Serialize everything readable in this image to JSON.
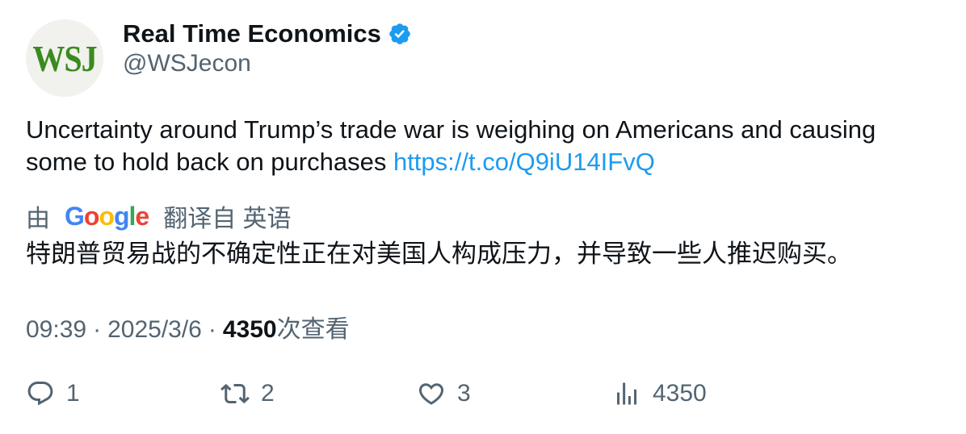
{
  "account": {
    "avatar_text": "WSJ",
    "display_name": "Real Time Economics",
    "handle": "@WSJecon",
    "verified_icon": "verified-badge-icon"
  },
  "tweet": {
    "text": "Uncertainty around Trump’s trade war is weighing on Americans and causing some to hold back on purchases",
    "link": "https://t.co/Q9iU14IFvQ"
  },
  "translation": {
    "prefix": "由",
    "provider": "Google",
    "suffix": "翻译自 英语",
    "text": "特朗普贸易战的不确定性正在对美国人构成压力，并导致一些人推迟购买。"
  },
  "meta": {
    "time": "09:39",
    "sep1": "·",
    "date": "2025/3/6",
    "sep2": "·",
    "views_count": "4350",
    "views_label": "次查看"
  },
  "actions": {
    "reply_count": "1",
    "retweet_count": "2",
    "like_count": "3",
    "views_count": "4350"
  },
  "colors": {
    "link": "#1d9bf0",
    "secondary_text": "#536471",
    "primary_text": "#0f1419",
    "avatar_logo": "#3b8a1e"
  }
}
